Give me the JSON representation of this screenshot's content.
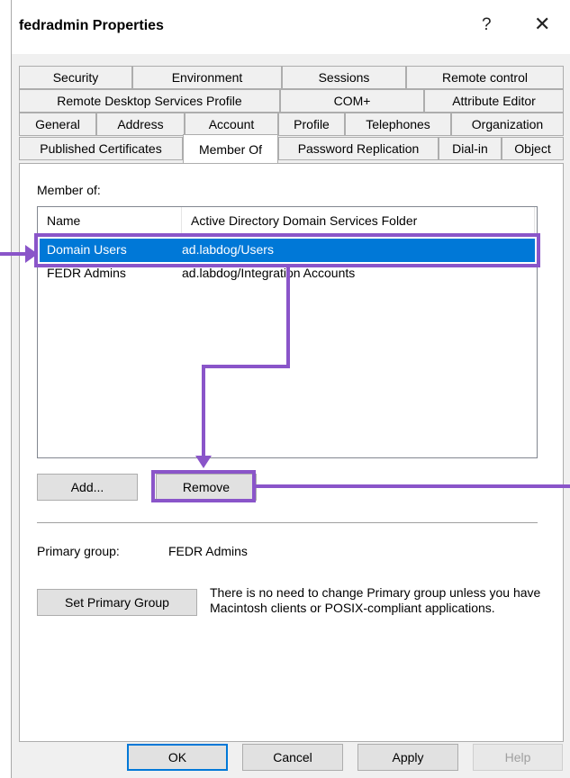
{
  "window": {
    "title": "fedradmin Properties",
    "help_glyph": "?",
    "close_glyph": "✕"
  },
  "tabs": {
    "row1": [
      "Security",
      "Environment",
      "Sessions",
      "Remote control"
    ],
    "row2": [
      "Remote Desktop Services Profile",
      "COM+",
      "Attribute Editor"
    ],
    "row3": [
      "General",
      "Address",
      "Account",
      "Profile",
      "Telephones",
      "Organization"
    ],
    "row4": [
      "Published Certificates",
      "Member Of",
      "Password Replication",
      "Dial-in",
      "Object"
    ],
    "active": "Member Of"
  },
  "member_of": {
    "label": "Member of:",
    "columns": [
      "Name",
      "Active Directory Domain Services Folder"
    ],
    "rows": [
      {
        "name": "Domain Users",
        "folder": "ad.labdog/Users",
        "selected": true
      },
      {
        "name": "FEDR Admins",
        "folder": "ad.labdog/Integration Accounts",
        "selected": false
      }
    ],
    "add_label": "Add...",
    "remove_label": "Remove"
  },
  "primary_group": {
    "label": "Primary group:",
    "value": "FEDR Admins",
    "set_button_label": "Set Primary Group",
    "note": "There is no need to change Primary group unless you have Macintosh clients or POSIX-compliant applications."
  },
  "footer": {
    "ok_label": "OK",
    "cancel_label": "Cancel",
    "apply_label": "Apply",
    "help_label": "Help"
  },
  "colors": {
    "annotation": "#8a55c9",
    "selection": "#0078d7"
  }
}
